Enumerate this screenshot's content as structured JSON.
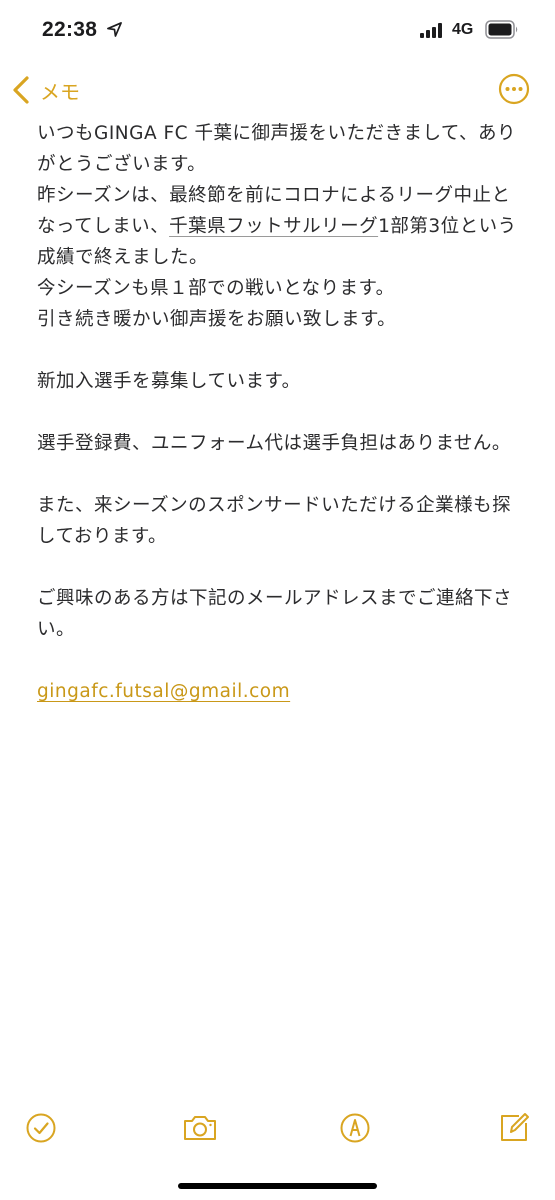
{
  "status_bar": {
    "time": "22:38",
    "network": "4G",
    "icons": [
      "location-arrow-icon",
      "signal-bars-icon",
      "battery-icon"
    ]
  },
  "nav": {
    "back_label": "メモ",
    "more_icon": "ellipsis-circle-icon"
  },
  "note": {
    "line1": "いつもGINGA FC 千葉に御声援をいただきまして、ありがとうございます。",
    "line2_pre": "昨シーズンは、最終節を前にコロナによるリーグ中止となってしまい、",
    "line2_link": "千葉県フットサルリーグ",
    "line2_post": "1部第3位という成績で終えました。",
    "line3": "今シーズンも県１部での戦いとなります。",
    "line4": "引き続き暖かい御声援をお願い致します。",
    "line5": "新加入選手を募集しています。",
    "line6": "選手登録費、ユニフォーム代は選手負担はありません。",
    "line7": "また、来シーズンのスポンサードいただける企業様も探しております。",
    "line8": "ご興味のある方は下記のメールアドレスまでご連絡下さい。",
    "email": "gingafc.futsal@gmail.com"
  },
  "toolbar": {
    "icons": [
      "checklist-icon",
      "camera-icon",
      "markup-icon",
      "compose-icon"
    ]
  },
  "colors": {
    "accent": "#d9a521",
    "text": "#2c2c2e",
    "background": "#ffffff"
  }
}
